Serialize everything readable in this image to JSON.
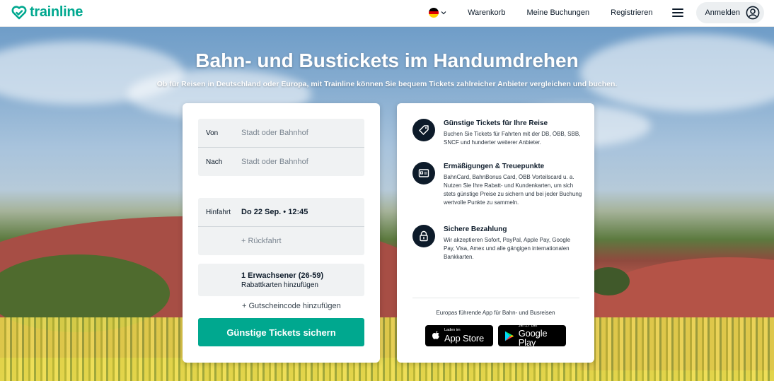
{
  "header": {
    "logo_text": "trainline",
    "language": "de",
    "nav": {
      "cart": "Warenkorb",
      "bookings": "Meine Buchungen",
      "register": "Registrieren",
      "login": "Anmelden"
    }
  },
  "hero": {
    "title": "Bahn- und Bustickets im Handumdrehen",
    "subtitle": "Ob für Reisen in Deutschland oder Europa, mit Trainline können Sie bequem Tickets zahlreicher Anbieter vergleichen und buchen."
  },
  "search": {
    "from_label": "Von",
    "from_placeholder": "Stadt oder Bahnhof",
    "to_label": "Nach",
    "to_placeholder": "Stadt oder Bahnhof",
    "outbound_label": "Hinfahrt",
    "outbound_value": "Do 22 Sep. • 12:45",
    "return_label": "+ Rückfahrt",
    "passengers": "1 Erwachsener (26-59)",
    "railcards": "Rabattkarten hinzufügen",
    "voucher": "+ Gutscheincode hinzufügen",
    "submit": "Günstige Tickets sichern"
  },
  "features": [
    {
      "title": "Günstige Tickets für Ihre Reise",
      "description": "Buchen Sie Tickets für Fahrten mit der DB, ÖBB, SBB, SNCF und hunderter weiterer Anbieter.",
      "icon": "tag-icon"
    },
    {
      "title": "Ermäßigungen & Treuepunkte",
      "description": "BahnCard, BahnBonus Card, ÖBB Vorteilscard u. a. Nutzen Sie Ihre Rabatt- und Kundenkarten, um sich stets günstige Preise zu sichern und bei jeder Buchung wertvolle Punkte zu sammeln.",
      "icon": "card-icon"
    },
    {
      "title": "Sichere Bezahlung",
      "description": "Wir akzeptieren Sofort, PayPal, Apple Pay, Google Pay, Visa, Amex und alle gängigen internationalen Bankkarten.",
      "icon": "lock-icon"
    }
  ],
  "apps": {
    "caption": "Europas führende App für Bahn- und Busreisen",
    "app_store_small": "Laden im",
    "app_store_big": "App Store",
    "google_play_small": "JETZT BEI",
    "google_play_big": "Google Play"
  },
  "colors": {
    "brand": "#00a88f",
    "dark": "#0d1b2a"
  }
}
